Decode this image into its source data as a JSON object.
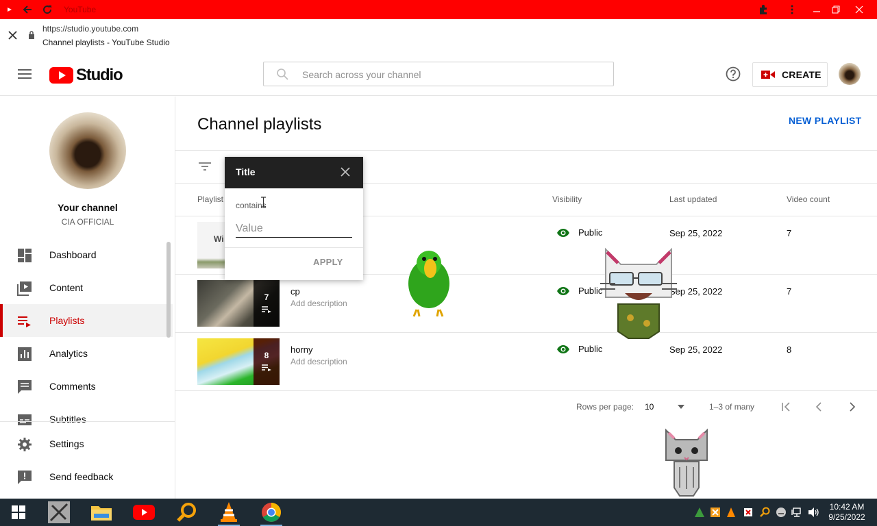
{
  "browser": {
    "tab_title": "YouTube",
    "url": "https://studio.youtube.com",
    "page_title": "Channel playlists - YouTube Studio"
  },
  "header": {
    "logo_text": "Studio",
    "search_placeholder": "Search across your channel",
    "create_label": "CREATE"
  },
  "sidebar": {
    "channel_label": "Your channel",
    "channel_name": "CIA OFFICIAL",
    "items": [
      {
        "label": "Dashboard",
        "icon": "dashboard-icon"
      },
      {
        "label": "Content",
        "icon": "content-icon"
      },
      {
        "label": "Playlists",
        "icon": "playlists-icon",
        "active": true
      },
      {
        "label": "Analytics",
        "icon": "analytics-icon"
      },
      {
        "label": "Comments",
        "icon": "comments-icon"
      },
      {
        "label": "Subtitles",
        "icon": "subtitles-icon"
      }
    ],
    "bottom_items": [
      {
        "label": "Settings",
        "icon": "gear-icon"
      },
      {
        "label": "Send feedback",
        "icon": "feedback-icon"
      }
    ]
  },
  "main": {
    "title": "Channel playlists",
    "new_playlist": "NEW PLAYLIST",
    "columns": {
      "playlist": "Playlist",
      "visibility": "Visibility",
      "last_updated": "Last updated",
      "video_count": "Video count"
    },
    "rows": [
      {
        "title": "",
        "description": "",
        "visibility": "Public",
        "updated": "Sep 25, 2022",
        "count": "7",
        "thumb_count": ""
      },
      {
        "title": "cp",
        "description": "Add description",
        "visibility": "Public",
        "updated": "Sep 25, 2022",
        "count": "7",
        "thumb_count": "7"
      },
      {
        "title": "horny",
        "description": "Add description",
        "visibility": "Public",
        "updated": "Sep 25, 2022",
        "count": "8",
        "thumb_count": "8"
      }
    ],
    "pagination": {
      "rows_per_page_label": "Rows per page:",
      "rows_per_page": "10",
      "range": "1–3 of many"
    }
  },
  "filter_popup": {
    "title": "Title",
    "operator": "contains",
    "value_placeholder": "Value",
    "apply": "APPLY"
  },
  "taskbar": {
    "time": "10:42 AM",
    "date": "9/25/2022"
  },
  "colors": {
    "youtube_red": "#ff0000",
    "active_red": "#cc0000",
    "link_blue": "#065fd4",
    "public_green": "#107516"
  }
}
